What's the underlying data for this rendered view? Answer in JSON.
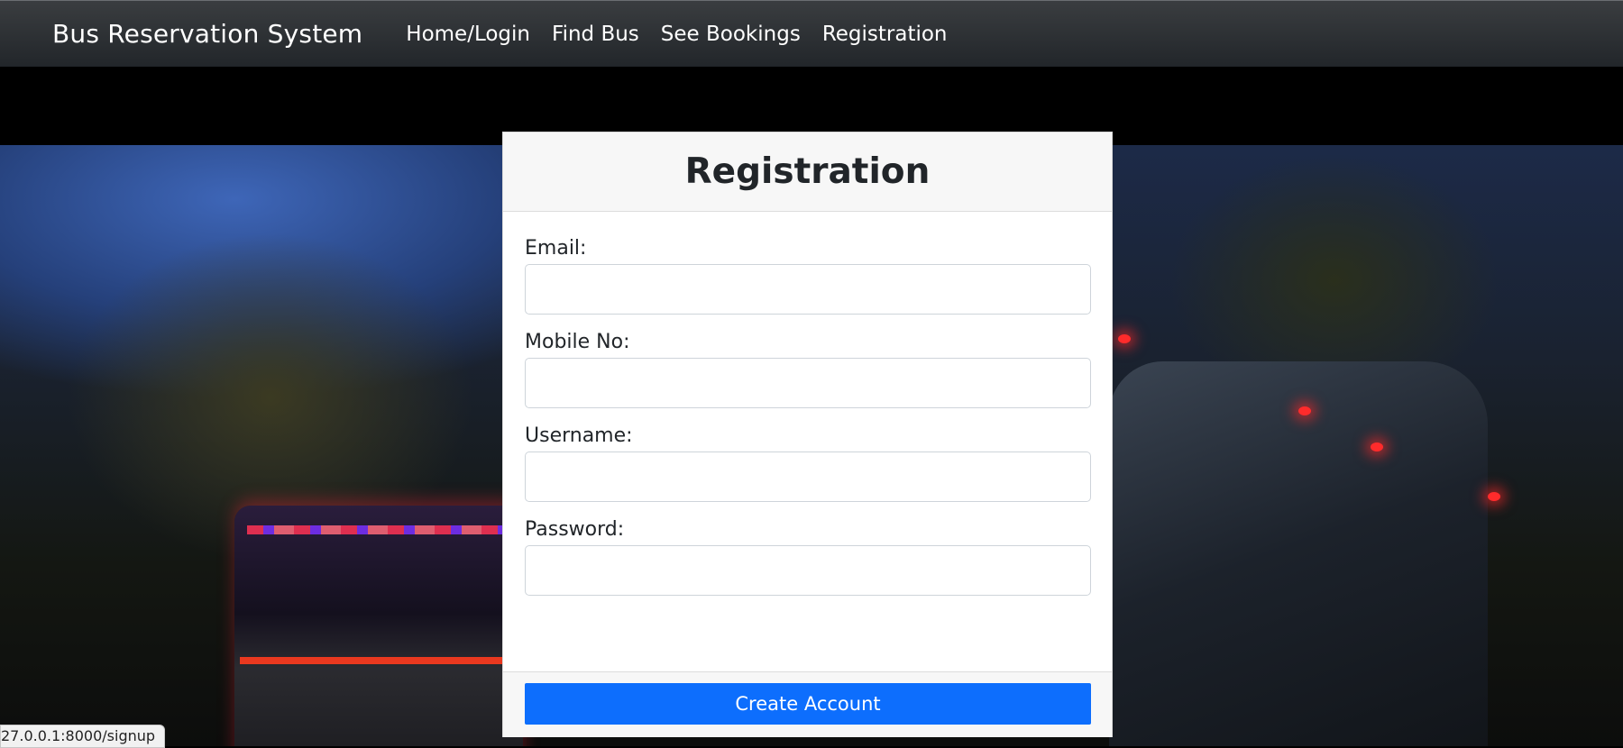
{
  "navbar": {
    "brand": "Bus Reservation System",
    "links": [
      "Home/Login",
      "Find Bus",
      "See Bookings",
      "Registration"
    ]
  },
  "form": {
    "title": "Registration",
    "fields": [
      {
        "label": "Email:",
        "value": ""
      },
      {
        "label": "Mobile No:",
        "value": ""
      },
      {
        "label": "Username:",
        "value": ""
      },
      {
        "label": "Password:",
        "value": ""
      }
    ],
    "submit_label": "Create Account"
  },
  "status_bar": {
    "url": "27.0.0.1:8000/signup"
  },
  "colors": {
    "primary": "#0d6efd",
    "navbar": "#2b2f33"
  }
}
